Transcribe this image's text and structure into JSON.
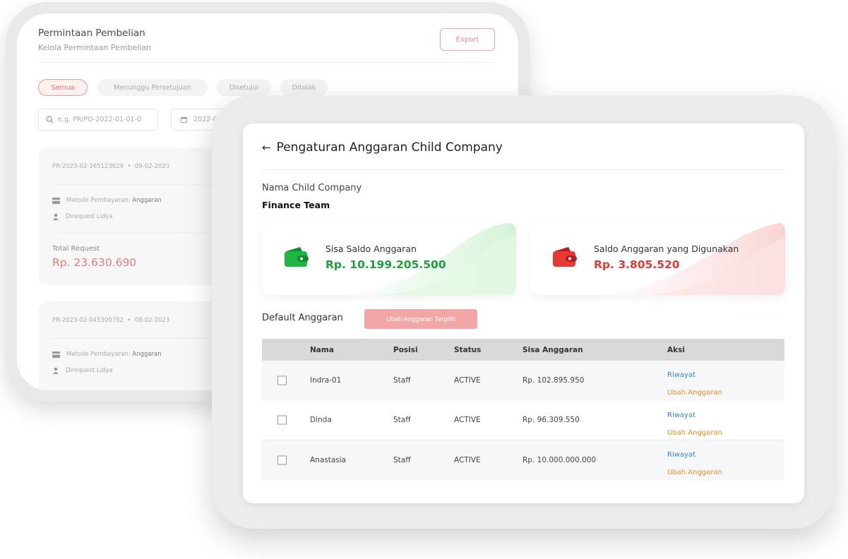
{
  "back": {
    "title": "Permintaan Pembelian",
    "subtitle": "Kelola Permintaan Pembelian",
    "export_label": "Export",
    "tabs": [
      "Semua",
      "Menunggu Persetujuan",
      "Disetujui",
      "Ditolak"
    ],
    "search_placeholder": "e.g. PR/PO-2022-01-01-0",
    "date_value": "2022-0",
    "cards": [
      {
        "ref": "PR-2023-02-165123629",
        "date": "09-02-2023",
        "payment_label": "Metode Pembayaran:",
        "payment_value": "Anggaran",
        "requested_label": "Direquest",
        "requested_by": "Lidya",
        "total_label": "Total Request",
        "total_value": "Rp. 23.630.690"
      },
      {
        "ref": "PR-2023-02-045300752",
        "date": "08-02-2023",
        "payment_label": "Metode Pembayaran:",
        "payment_value": "Anggaran",
        "requested_label": "Direquest",
        "requested_by": "Lidya"
      }
    ]
  },
  "front": {
    "title": "Pengaturan Anggaran Child Company",
    "company_label": "Nama Child Company",
    "company_value": "Finance Team",
    "sisa_saldo": {
      "label": "Sisa Saldo Anggaran",
      "value": "Rp. 10.199.205.500",
      "color": "#1f9e3a"
    },
    "saldo_digunakan": {
      "label": "Saldo Anggaran yang Digunakan",
      "value": "Rp. 3.805.520",
      "color": "#e53935"
    },
    "default_label": "Default Anggaran",
    "bulk_button": "Ubah Anggaran Terpilih",
    "table": {
      "headers": [
        "Nama",
        "Posisi",
        "Status",
        "Sisa Anggaran",
        "Aksi"
      ],
      "rows": [
        {
          "nama": "Indra-01",
          "posisi": "Staff",
          "status": "ACTIVE",
          "sisa": "Rp. 102.895.950",
          "aksi1": "Riwayat",
          "aksi2": "Ubah Anggaran"
        },
        {
          "nama": "Dinda",
          "posisi": "Staff",
          "status": "ACTIVE",
          "sisa": "Rp. 96.309.550",
          "aksi1": "Riwayat",
          "aksi2": "Ubah Anggaran"
        },
        {
          "nama": "Anastasia",
          "posisi": "Staff",
          "status": "ACTIVE",
          "sisa": "Rp. 10.000.000.000",
          "aksi1": "Riwayat",
          "aksi2": "Ubah Anggaran"
        }
      ]
    }
  }
}
